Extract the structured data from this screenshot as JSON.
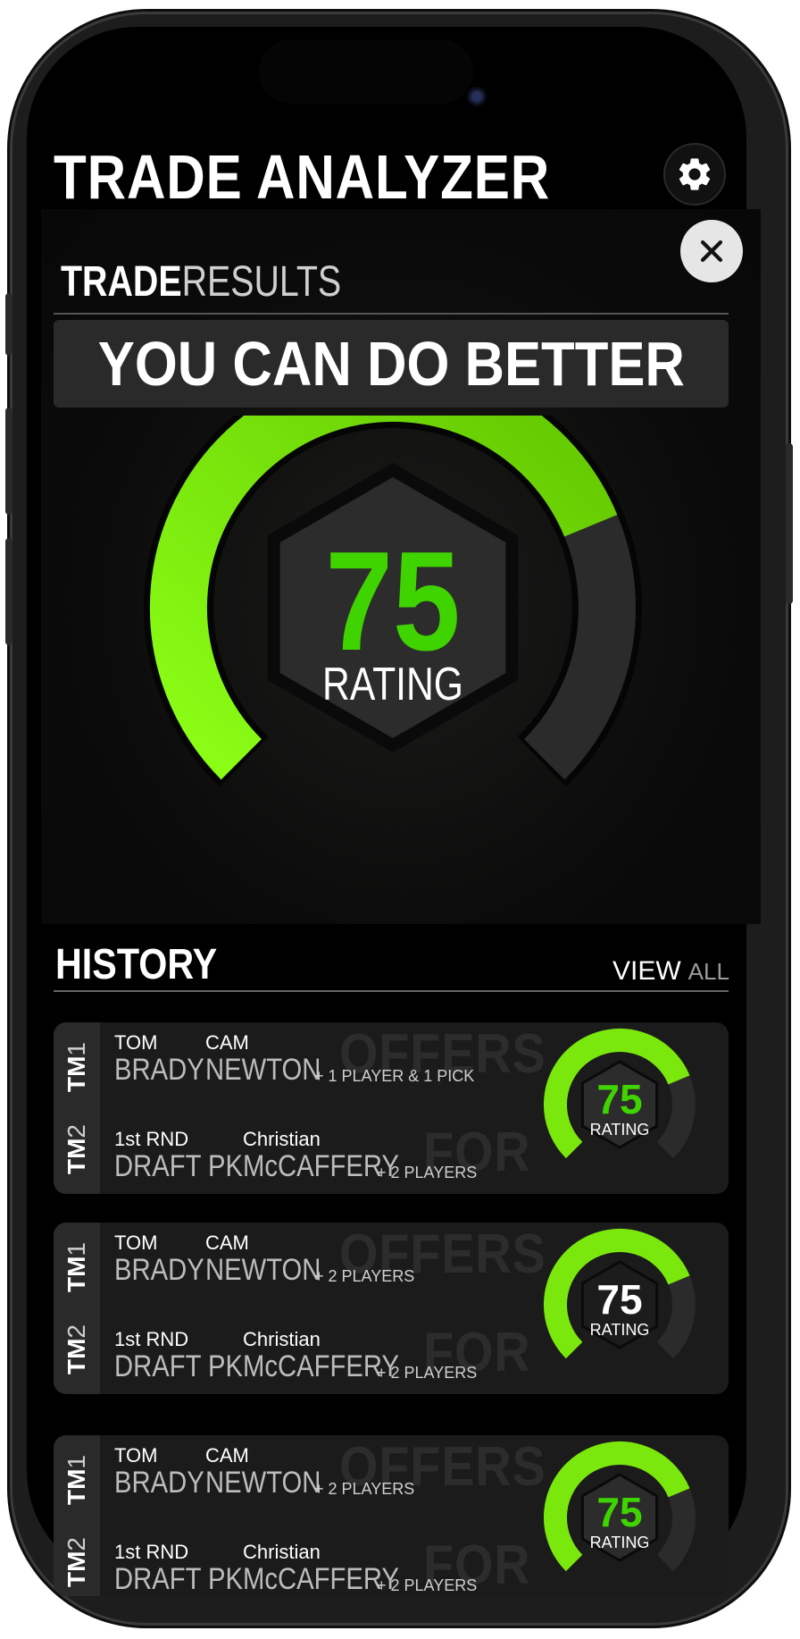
{
  "app": {
    "title": "TRADE ANALYZER"
  },
  "results": {
    "heading_bold": "TRADE",
    "heading_light": "RESULTS",
    "verdict": "YOU CAN DO BETTER",
    "rating": 75,
    "rating_label": "RATING",
    "max_rating": 100
  },
  "history": {
    "title": "HISTORY",
    "view_label": "VIEW",
    "all_label": "ALL",
    "watermark_offers": "OFFERS",
    "watermark_for": "FOR",
    "team_prefix": "TM",
    "team1_num": "1",
    "team2_num": "2",
    "trades": [
      {
        "tm1_first": [
          "TOM",
          "CAM"
        ],
        "tm1_last": [
          "BRADY",
          "NEWTON"
        ],
        "tm1_extra": "+ 1 PLAYER & 1 PICK",
        "tm2_first": [
          "1st RND",
          "Christian"
        ],
        "tm2_last": [
          "DRAFT PK",
          "McCAFFERY"
        ],
        "tm2_extra": "+ 2 PLAYERS",
        "rating": 75,
        "rating_label": "RATING"
      },
      {
        "tm1_first": [
          "TOM",
          "CAM"
        ],
        "tm1_last": [
          "BRADY",
          "NEWTON"
        ],
        "tm1_extra": "+ 2 PLAYERS",
        "tm2_first": [
          "1st RND",
          "Christian"
        ],
        "tm2_last": [
          "DRAFT PK",
          "McCAFFERY"
        ],
        "tm2_extra": "+ 2 PLAYERS",
        "rating": 75,
        "rating_label": "RATING"
      },
      {
        "tm1_first": [
          "TOM",
          "CAM"
        ],
        "tm1_last": [
          "BRADY",
          "NEWTON"
        ],
        "tm1_extra": "+ 2 PLAYERS",
        "tm2_first": [
          "1st RND",
          "Christian"
        ],
        "tm2_last": [
          "DRAFT PK",
          "McCAFFERY"
        ],
        "tm2_extra": "+ 2 PLAYERS",
        "rating": 75,
        "rating_label": "RATING"
      }
    ]
  },
  "colors": {
    "accent_green": "#3fd400",
    "arc_bright": "#8cff16",
    "arc_dark": "#62c600",
    "track": "#2b2b2b"
  },
  "icons": {
    "settings": "gear-icon",
    "close": "close-icon"
  }
}
